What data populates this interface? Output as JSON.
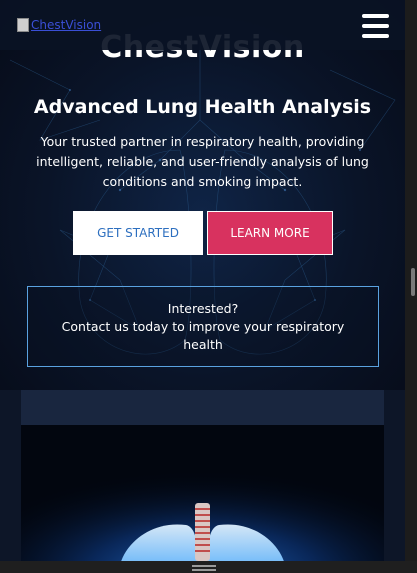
{
  "navbar": {
    "logo_alt": "ChestVision",
    "menu_icon": "hamburger-menu-icon"
  },
  "hero": {
    "brand": "ChestVision",
    "headline": "Advanced Lung Health Analysis",
    "tagline": "Your trusted partner in respiratory health, providing intelligent, reliable, and user-friendly analysis of lung conditions and smoking impact.",
    "buttons": {
      "get_started": "GET STARTED",
      "learn_more": "LEARN MORE"
    },
    "contact": {
      "line1": "Interested?",
      "line2": "Contact us today to improve your respiratory health"
    }
  },
  "colors": {
    "background": "#0b1223",
    "accent_pink": "#d8325f",
    "accent_blue": "#2d6fbf",
    "contact_border": "#5aa2e0"
  }
}
